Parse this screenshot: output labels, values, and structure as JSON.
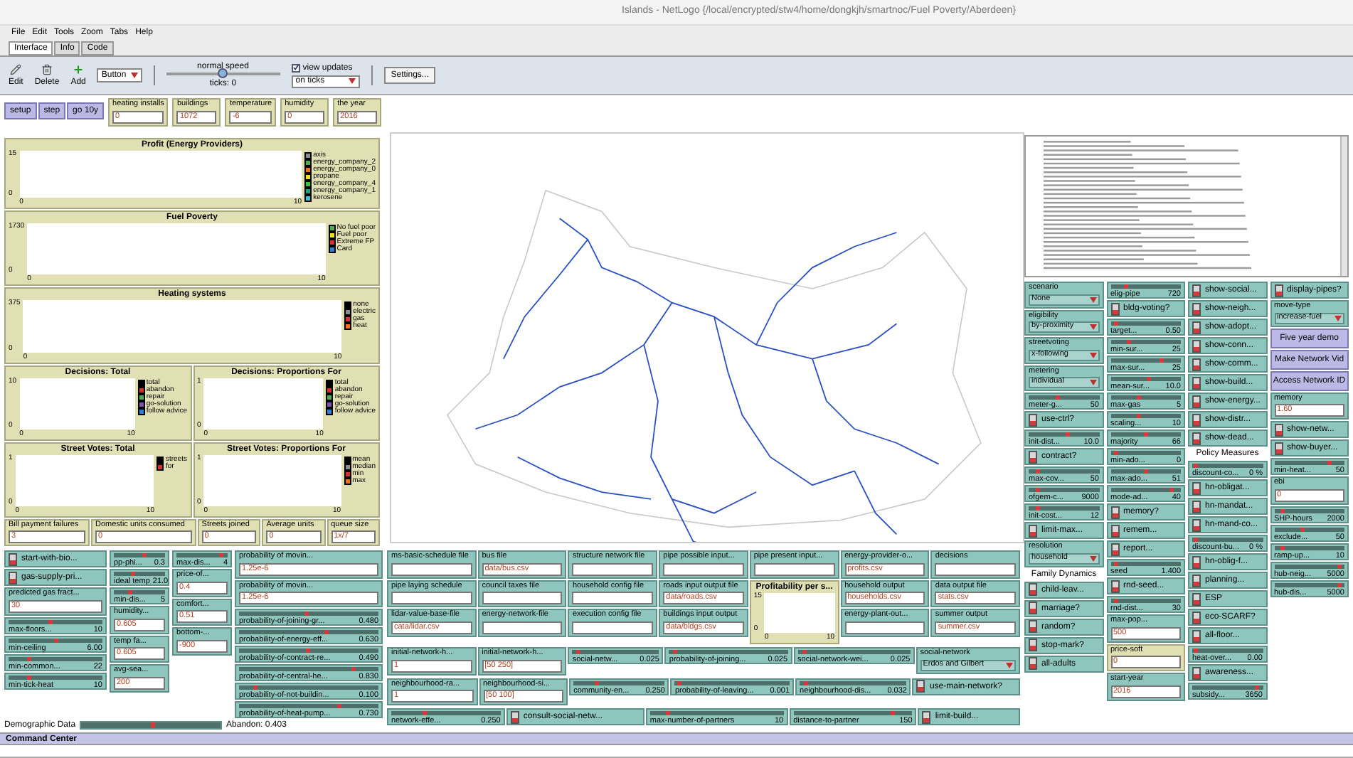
{
  "window": {
    "title": "Islands - NetLogo {/local/encrypted/stw4/home/dongkjh/smartnoc/Fuel Poverty/Aberdeen}"
  },
  "menu": [
    "File",
    "Edit",
    "Tools",
    "Zoom",
    "Tabs",
    "Help"
  ],
  "tabs": [
    {
      "label": "Interface",
      "selected": true
    },
    {
      "label": "Info",
      "selected": false
    },
    {
      "label": "Code",
      "selected": false
    }
  ],
  "toolbar": {
    "edit": "Edit",
    "delete": "Delete",
    "add": "Add",
    "widget_type": "Button",
    "speed": {
      "label": "normal speed",
      "level": 0.5,
      "reading": "ticks: 0"
    },
    "view_updates": {
      "label": "view updates",
      "checked": true
    },
    "update_mode": "on ticks",
    "settings": "Settings..."
  },
  "buttons": [
    "setup",
    "step",
    "go 10y"
  ],
  "monitors": [
    {
      "label": "heating installs",
      "value": "0"
    },
    {
      "label": "buildings",
      "value": "1072"
    },
    {
      "label": "temperature",
      "value": "-6"
    },
    {
      "label": "humidity",
      "value": "0"
    },
    {
      "label": "the year",
      "value": "2016"
    }
  ],
  "plots": [
    {
      "title": "Profit (Energy Providers)",
      "y_max": "15",
      "y_min": "0",
      "x_min": "0",
      "x_max": "10",
      "legend": [
        {
          "label": "axis",
          "color": "#8c8c8c"
        },
        {
          "label": "energy_company_2",
          "color": "#4caf50"
        },
        {
          "label": "energy_company_0",
          "color": "#f07020"
        },
        {
          "label": "propane",
          "color": "#f0e020"
        },
        {
          "label": "energy_company_4",
          "color": "#40c040"
        },
        {
          "label": "energy_company_1",
          "color": "#20a080"
        },
        {
          "label": "kerosene",
          "color": "#40c0d0"
        }
      ]
    },
    {
      "title": "Fuel Poverty",
      "y_max": "1730",
      "y_min": "0",
      "x_min": "0",
      "x_max": "10",
      "legend": [
        {
          "label": "No fuel poor",
          "color": "#4caf50"
        },
        {
          "label": "Fuel poor",
          "color": "#f0e020"
        },
        {
          "label": "Extreme FP",
          "color": "#d83030"
        },
        {
          "label": "Card",
          "color": "#3080d0"
        }
      ]
    },
    {
      "title": "Heating systems",
      "y_max": "375",
      "y_min": "0",
      "x_min": "0",
      "x_max": "10",
      "legend": [
        {
          "label": "none",
          "color": "#000000"
        },
        {
          "label": "electric",
          "color": "#8c8c8c"
        },
        {
          "label": "gas",
          "color": "#d83030"
        },
        {
          "label": "heat",
          "color": "#f07020"
        }
      ]
    },
    {
      "title": "Decisions: Total",
      "y_max": "10",
      "y_min": "0",
      "x_min": "0",
      "x_max": "10",
      "legend": [
        {
          "label": "total",
          "color": "#000000"
        },
        {
          "label": "abandon",
          "color": "#d83030"
        },
        {
          "label": "repair",
          "color": "#4caf50"
        },
        {
          "label": "go-solution",
          "color": "#8050b0"
        },
        {
          "label": "follow advice",
          "color": "#3080d0"
        }
      ]
    },
    {
      "title": "Decisions: Proportions For",
      "y_max": "1",
      "y_min": "0",
      "x_min": "0",
      "x_max": "10",
      "legend": [
        {
          "label": "total",
          "color": "#000000"
        },
        {
          "label": "abandon",
          "color": "#d83030"
        },
        {
          "label": "repair",
          "color": "#4caf50"
        },
        {
          "label": "go-solution",
          "color": "#8050b0"
        },
        {
          "label": "follow advice",
          "color": "#3080d0"
        }
      ]
    },
    {
      "title": "Street Votes: Total",
      "y_max": "1",
      "y_min": "0",
      "x_min": "0",
      "x_max": "10",
      "legend": [
        {
          "label": "streets",
          "color": "#000000"
        },
        {
          "label": "for",
          "color": "#d83030"
        }
      ]
    },
    {
      "title": "Street Votes: Proportions For",
      "y_max": "1",
      "y_min": "0",
      "x_min": "0",
      "x_max": "10",
      "legend": [
        {
          "label": "mean",
          "color": "#000000"
        },
        {
          "label": "median",
          "color": "#8c8c8c"
        },
        {
          "label": "min",
          "color": "#d83030"
        },
        {
          "label": "max",
          "color": "#f07020"
        }
      ]
    }
  ],
  "summary_monitors": [
    {
      "label": "Bill payment failures",
      "value": "3"
    },
    {
      "label": "Domestic units consumed",
      "value": "0"
    },
    {
      "label": "Streets joined",
      "value": "0"
    },
    {
      "label": "Average units",
      "value": "0"
    },
    {
      "label": "queue size",
      "value": "1x/7"
    }
  ],
  "bottom_left": [
    [
      {
        "kind": "switch",
        "label": "start-with-bio...",
        "on": false
      },
      {
        "kind": "switch",
        "label": "gas-supply-pri...",
        "on": false
      },
      {
        "kind": "input",
        "label": "predicted gas fract...",
        "value": "30"
      },
      {
        "kind": "slider",
        "label": "max-floors...",
        "value": "10",
        "level": 0.45
      },
      {
        "kind": "slider",
        "label": "min-ceiling",
        "value": "6.00",
        "level": 0.5
      },
      {
        "kind": "slider",
        "label": "min-common...",
        "value": "22",
        "level": 0.2
      },
      {
        "kind": "slider",
        "label": "min-tick-heat",
        "value": "10",
        "level": 0.2
      }
    ],
    [
      {
        "kind": "slider",
        "label": "pp-phi...",
        "value": "0.3",
        "level": 0.6
      },
      {
        "kind": "slider",
        "label": "ideal temp",
        "value": "21.0",
        "level": 0.35
      },
      {
        "kind": "slider",
        "label": "min-dis...",
        "value": "5",
        "level": 0.3
      },
      {
        "kind": "input",
        "label": "humidity...",
        "value": "0.605"
      },
      {
        "kind": "input",
        "label": "temp fa...",
        "value": "0.605"
      },
      {
        "kind": "input",
        "label": "avg-sea...",
        "value": "200"
      }
    ],
    [
      {
        "kind": "slider",
        "label": "max-dis...",
        "value": "4",
        "level": 0.9
      },
      {
        "kind": "input",
        "label": "price-of...",
        "value": "0.4"
      },
      {
        "kind": "input",
        "label": "comfort...",
        "value": "0.51"
      },
      {
        "kind": "input",
        "label": "bottom-...",
        "value": "-900"
      }
    ],
    [
      {
        "kind": "input",
        "label": "probability of movin...",
        "value": "1.25e-6"
      },
      {
        "kind": "input",
        "label": "probability of movin...",
        "value": "1.25e-6"
      },
      {
        "kind": "slider",
        "label": "probability-of-joining-gr...",
        "value": "0.480",
        "level": 0.48
      },
      {
        "kind": "slider",
        "label": "probability-of-energy-eff...",
        "value": "0.630",
        "level": 0.63
      },
      {
        "kind": "slider",
        "label": "probability-of-contract-re...",
        "value": "0.490",
        "level": 0.49
      },
      {
        "kind": "slider",
        "label": "probability-of-central-he...",
        "value": "0.830",
        "level": 0.83
      },
      {
        "kind": "slider",
        "label": "probability-of-not-buildin...",
        "value": "0.100",
        "level": 0.1
      },
      {
        "kind": "slider",
        "label": "probability-of-heat-pump...",
        "value": "0.730",
        "level": 0.73
      }
    ]
  ],
  "status": {
    "label": "Demographic Data",
    "level": 0.5,
    "reading": "Abandon: 0.403"
  },
  "file_columns": [
    [
      {
        "kind": "input",
        "label": "ms-basic-schedule file"
      },
      {
        "kind": "input",
        "label": "pipe laying schedule"
      },
      {
        "kind": "input",
        "label": "lidar-value-base-file",
        "value": "cata/lidar.csv"
      }
    ],
    [
      {
        "kind": "input",
        "label": "bus file",
        "value": "data/bus.csv"
      },
      {
        "kind": "input",
        "label": "council taxes file"
      },
      {
        "kind": "input",
        "label": "energy-network-file"
      }
    ],
    [
      {
        "kind": "input",
        "label": "structure network file"
      },
      {
        "kind": "input",
        "label": "household config file"
      },
      {
        "kind": "input",
        "label": "execution config file"
      }
    ],
    [
      {
        "kind": "input",
        "label": "pipe possible input..."
      },
      {
        "kind": "input",
        "label": "roads input output file",
        "value": "data/roads.csv"
      },
      {
        "kind": "input",
        "label": "buildings input output",
        "value": "data/bldgs.csv"
      }
    ],
    [
      {
        "kind": "input",
        "label": "pipe present input..."
      },
      {
        "kind": "plot",
        "title": "Profitability per s...",
        "y_max": "15",
        "y_min": "0",
        "x_min": "0",
        "x_max": "10"
      }
    ],
    [
      {
        "kind": "input",
        "label": "energy-provider-o...",
        "value": "profits.csv"
      },
      {
        "kind": "input",
        "label": "household output",
        "value": "households.csv"
      },
      {
        "kind": "input",
        "label": "energy-plant-out..."
      }
    ],
    [
      {
        "kind": "input",
        "label": "decisions"
      },
      {
        "kind": "input",
        "label": "data output file",
        "value": "stats.csv"
      },
      {
        "kind": "input",
        "label": "summer output",
        "value": "summer.csv"
      }
    ]
  ],
  "slider_rows": [
    [
      {
        "kind": "input",
        "label": "initial-network-h...",
        "value": "1"
      },
      {
        "kind": "input",
        "label": "initial-network-h...",
        "value": "[50 250]"
      },
      {
        "kind": "slider",
        "label": "social-netw...",
        "value": "0.025",
        "level": 0.05
      },
      {
        "kind": "slider",
        "label": "probability-of-joining...",
        "value": "0.025",
        "level": 0.03
      },
      {
        "kind": "slider",
        "label": "social-network-wei...",
        "value": "0.025",
        "level": 0.04
      },
      {
        "kind": "chooser",
        "label": "social-network",
        "value": "Erdos and Gilbert"
      }
    ],
    [
      {
        "kind": "input",
        "label": "neighbourhood-ra...",
        "value": "1"
      },
      {
        "kind": "input",
        "label": "neighbourhood-si...",
        "value": "[50 100]"
      },
      {
        "kind": "slider",
        "label": "community-en...",
        "value": "0.250",
        "level": 0.25
      },
      {
        "kind": "slider",
        "label": "probability-of-leaving...",
        "value": "0.001",
        "level": 0.02
      },
      {
        "kind": "slider",
        "label": "neighbourhood-dis...",
        "value": "0.032",
        "level": 0.04
      },
      {
        "kind": "switch",
        "label": "use-main-network?",
        "on": false
      }
    ],
    [
      {
        "kind": "slider",
        "label": "network-effe...",
        "value": "0.250",
        "level": 0.3
      },
      {
        "kind": "switch",
        "label": "consult-social-netw...",
        "on": false
      },
      {
        "kind": "slider",
        "label": "max-number-of-partners",
        "value": "10",
        "level": 0.12
      },
      {
        "kind": "slider",
        "label": "distance-to-partner",
        "value": "150",
        "level": 0.85
      },
      {
        "kind": "switch",
        "label": "limit-build...",
        "on": false
      }
    ]
  ],
  "right_columns": [
    [
      {
        "kind": "chooser",
        "label": "scenario",
        "value": "None"
      },
      {
        "kind": "chooser",
        "label": "eligibility",
        "value": "by-proximity"
      },
      {
        "kind": "chooser",
        "label": "streetvoting",
        "value": "x-following"
      },
      {
        "kind": "chooser",
        "label": "metering",
        "value": "individual"
      },
      {
        "kind": "slider",
        "label": "meter-g...",
        "value": "50",
        "level": 0.4
      },
      {
        "kind": "switch",
        "label": "use-ctrl?",
        "on": false
      },
      {
        "kind": "slider",
        "label": "init-dist...",
        "value": "10.0",
        "level": 0.55
      },
      {
        "kind": "switch",
        "label": "contract?",
        "on": false
      },
      {
        "kind": "slider",
        "label": "max-cov...",
        "value": "50",
        "level": 0.1
      },
      {
        "kind": "slider",
        "label": "ofgem-c...",
        "value": "9000",
        "level": 0.1
      },
      {
        "kind": "slider",
        "label": "init-cost...",
        "value": "12",
        "level": 0.1
      },
      {
        "kind": "switch",
        "label": "limit-max...",
        "on": false
      },
      {
        "kind": "chooser",
        "label": "resolution",
        "value": "household"
      },
      {
        "kind": "note",
        "label": "Family Dynamics"
      },
      {
        "kind": "switch",
        "label": "child-leav...",
        "on": false
      },
      {
        "kind": "switch",
        "label": "marriage?",
        "on": false
      },
      {
        "kind": "switch",
        "label": "random?",
        "on": false
      },
      {
        "kind": "switch",
        "label": "stop-mark?",
        "on": false
      },
      {
        "kind": "switch",
        "label": "all-adults",
        "on": false
      }
    ],
    [
      {
        "kind": "slider",
        "label": "elig-pipe",
        "value": "720",
        "level": 0.2
      },
      {
        "kind": "switch",
        "label": "bldg-voting?",
        "on": false
      },
      {
        "kind": "slider",
        "label": "target...",
        "value": "0.50",
        "level": 0.05
      },
      {
        "kind": "slider",
        "label": "min-sur...",
        "value": "25",
        "level": 0.25
      },
      {
        "kind": "slider",
        "label": "max-sur...",
        "value": "25",
        "level": 0.75
      },
      {
        "kind": "slider",
        "label": "mean-sur...",
        "value": "10.0",
        "level": 0.55
      },
      {
        "kind": "slider",
        "label": "max-gas",
        "value": "5",
        "level": 0.4
      },
      {
        "kind": "slider",
        "label": "scaling...",
        "value": "10",
        "level": 0.4
      },
      {
        "kind": "slider",
        "label": "majority",
        "value": "66",
        "level": 0.5
      },
      {
        "kind": "slider",
        "label": "min-ado...",
        "value": "0",
        "level": 0.05
      },
      {
        "kind": "slider",
        "label": "max-ado...",
        "value": "51",
        "level": 0.5
      },
      {
        "kind": "slider",
        "label": "mode-ad...",
        "value": "40",
        "level": 0.9
      },
      {
        "kind": "switch",
        "label": "memory?",
        "on": false
      },
      {
        "kind": "switch",
        "label": "remem...",
        "on": false
      },
      {
        "kind": "switch",
        "label": "report...",
        "on": false
      },
      {
        "kind": "slider",
        "label": "seed",
        "value": "1.400",
        "level": 0.05
      },
      {
        "kind": "switch",
        "label": "rnd-seed...",
        "on": false
      },
      {
        "kind": "slider",
        "label": "rnd-dist...",
        "value": "30",
        "level": 0.05
      },
      {
        "kind": "input",
        "label": "max-pop...",
        "value": "500"
      },
      {
        "kind": "monitor",
        "label": "price-soft",
        "value": "0"
      },
      {
        "kind": "input",
        "label": "start-year",
        "value": "2016"
      }
    ],
    [
      {
        "kind": "switch",
        "label": "show-social...",
        "on": false
      },
      {
        "kind": "switch",
        "label": "show-neigh...",
        "on": false
      },
      {
        "kind": "switch",
        "label": "show-adopt...",
        "on": false
      },
      {
        "kind": "switch",
        "label": "show-conn...",
        "on": false
      },
      {
        "kind": "switch",
        "label": "show-comm...",
        "on": false
      },
      {
        "kind": "switch",
        "label": "show-build...",
        "on": false
      },
      {
        "kind": "switch",
        "label": "show-energy...",
        "on": false
      },
      {
        "kind": "switch",
        "label": "show-distr...",
        "on": false
      },
      {
        "kind": "switch",
        "label": "show-dead...",
        "on": false
      },
      {
        "kind": "note",
        "label": "Policy Measures"
      },
      {
        "kind": "slider",
        "label": "discount-co...",
        "value": "0 %",
        "level": 0.02
      },
      {
        "kind": "switch",
        "label": "hn-obligat...",
        "on": false
      },
      {
        "kind": "switch",
        "label": "hn-mandat...",
        "on": false
      },
      {
        "kind": "switch",
        "label": "hn-mand-co...",
        "on": false
      },
      {
        "kind": "slider",
        "label": "discount-bu...",
        "value": "0 %",
        "level": 0.02
      },
      {
        "kind": "switch",
        "label": "hn-oblig-f...",
        "on": false
      },
      {
        "kind": "switch",
        "label": "planning...",
        "on": false
      },
      {
        "kind": "switch",
        "label": "ESP",
        "on": false
      },
      {
        "kind": "switch",
        "label": "eco-SCARF?",
        "on": false
      },
      {
        "kind": "switch",
        "label": "all-floor...",
        "on": false
      },
      {
        "kind": "slider",
        "label": "heat-over...",
        "value": "0.00",
        "level": 0.02
      },
      {
        "kind": "switch",
        "label": "awareness...",
        "on": false
      },
      {
        "kind": "slider",
        "label": "subsidy...",
        "value": "3650",
        "level": 0.95
      }
    ],
    [
      {
        "kind": "switch",
        "label": "display-pipes?",
        "on": false
      },
      {
        "kind": "chooser",
        "label": "move-type",
        "value": "increase-fuel"
      },
      {
        "kind": "button",
        "label": "Five year demo"
      },
      {
        "kind": "button",
        "label": "Make Network Vid"
      },
      {
        "kind": "button",
        "label": "Access Network ID"
      },
      {
        "kind": "input",
        "label": "memory",
        "value": "1.60"
      },
      {
        "kind": "switch",
        "label": "show-netw...",
        "on": false
      },
      {
        "kind": "switch",
        "label": "show-buyer...",
        "on": false
      },
      {
        "kind": "slider",
        "label": "min-heat...",
        "value": "50",
        "level": 0.8
      },
      {
        "kind": "input",
        "label": "ebi",
        "value": "0"
      },
      {
        "kind": "slider",
        "label": "SHP-hours",
        "value": "2000",
        "level": 0.1
      },
      {
        "kind": "slider",
        "label": "exclude...",
        "value": "50",
        "level": 0.4
      },
      {
        "kind": "slider",
        "label": "ramp-up...",
        "value": "10",
        "level": 0.1
      },
      {
        "kind": "slider",
        "label": "hub-neig...",
        "value": "5000",
        "level": 0.95
      },
      {
        "kind": "slider",
        "label": "hub-dis...",
        "value": "5000",
        "level": 0.95
      }
    ]
  ],
  "command_center": {
    "title": "Command Center"
  }
}
